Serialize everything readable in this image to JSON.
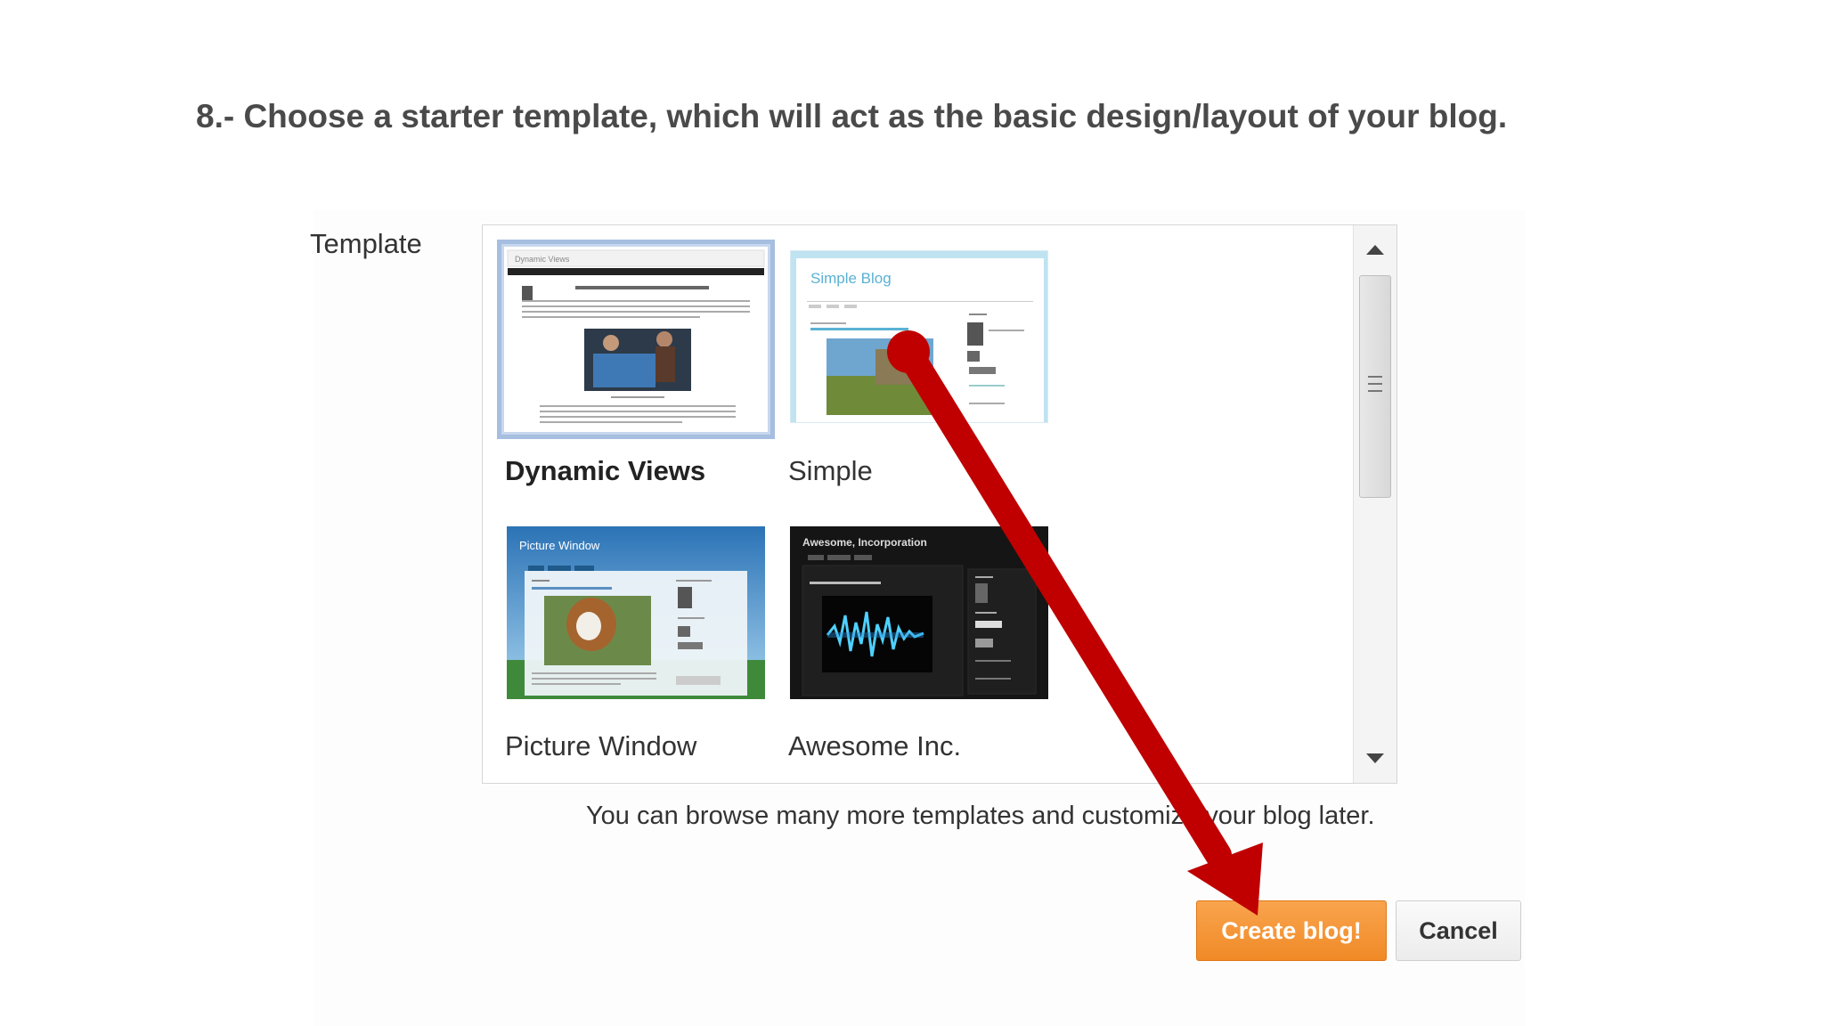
{
  "step": {
    "instruction": "8.- Choose a starter template, which will act as the basic design/layout of your blog."
  },
  "dialog": {
    "template_label": "Template",
    "templates": [
      {
        "name": "Dynamic Views",
        "thumb_title": "Dynamic Views",
        "selected": true
      },
      {
        "name": "Simple",
        "thumb_title": "Simple Blog",
        "selected": false
      },
      {
        "name": "Picture Window",
        "thumb_title": "Picture Window",
        "selected": false
      },
      {
        "name": "Awesome Inc.",
        "thumb_title": "Awesome, Incorporation",
        "selected": false
      }
    ],
    "note": "You can browse many more templates and customize your blog later.",
    "create_label": "Create blog!",
    "cancel_label": "Cancel"
  },
  "colors": {
    "accent_orange": "#f5922f",
    "arrow_red": "#c00000",
    "selected_border": "#a6bee0"
  },
  "icons": [
    "scroll-up-icon",
    "scroll-down-icon",
    "scroll-grip-icon",
    "pointer-arrow-icon"
  ]
}
